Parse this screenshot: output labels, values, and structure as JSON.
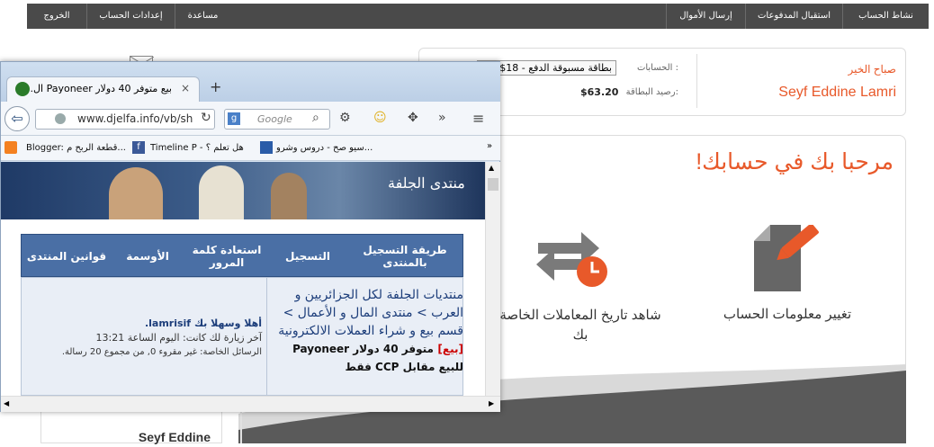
{
  "topnav": {
    "items": [
      "نشاط الحساب",
      "استقبال المدفوعات",
      "إرسال الأموال",
      "مساعدة",
      "إعدادات الحساب",
      "الخروج"
    ]
  },
  "header": {
    "greeting": "صباح الخير",
    "user_name": "Seyf Eddine Lamri",
    "accounts_label": "الحسابات :",
    "accounts_value": "بطاقة مسبوقة الدفع - 18$",
    "balance_label": "رصيد البطاقة:",
    "balance_value": "$63.20"
  },
  "main": {
    "welcome": "مرحبا بك في حسابك!",
    "action1": "تغيير معلومات الحساب",
    "action2": "شاهد تاريخ المعاملات الخاصة بك",
    "sidebar_name": "Seyf Eddine"
  },
  "browser": {
    "tab_title": "بيع متوفر 40 دولار Payoneer ال...",
    "new_tab": "+",
    "url": "www.djelfa.info/vb/sh",
    "search_placeholder": "Google",
    "bookmarks": [
      "Blogger: قطعة الربح م...",
      "Timeline P - هل تعلم ؟",
      "سيو صح - دروس وشرو..."
    ],
    "forum_nav": [
      "طريقة التسجيل بالمنتدى",
      "التسجيل",
      "استعادة كلمة المرور",
      "الأوسمة",
      "قوانين المنتدى"
    ],
    "breadcrumb": "منتديات الجلفة لكل الجزائريين و العرب > منتدى المال و الأعمال > قسم بيع و شراء العملات الالكترونية",
    "thread_tag": "[بيع]",
    "thread_title": "متوفر 40 دولار Payoneer للبيع مقابل CCP فقط",
    "welcome_user": "أهلا وسهلا بك lamrisif.",
    "last_visit": "آخر زيارة لك كانت: اليوم الساعة 13:21",
    "private_msgs": "الرسائل الخاصة: غير مقروء 0, من مجموع 20 رسالة.",
    "banner_logo": "منتدى الجلفة"
  },
  "colors": {
    "accent": "#e8592a",
    "topbar": "#4a4a4a",
    "forum_blue": "#4a6fa5"
  }
}
